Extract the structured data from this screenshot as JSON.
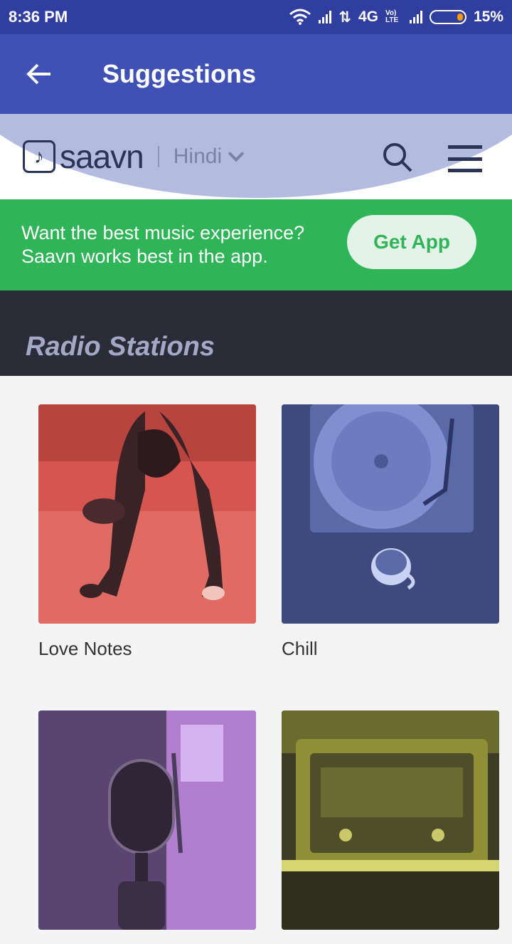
{
  "status_bar": {
    "time": "8:36 PM",
    "network": "4G",
    "battery": "15%",
    "volte": "Vo) LTE"
  },
  "app_bar": {
    "title": "Suggestions"
  },
  "saavn": {
    "logo": "saavn",
    "language": "Hindi"
  },
  "promo": {
    "line1": "Want the best music experience?",
    "line2": "Saavn works best in the app.",
    "button": "Get App"
  },
  "section": {
    "title": "Radio Stations"
  },
  "stations": [
    {
      "label": "Love Notes",
      "tint": "#d9534f"
    },
    {
      "label": "Chill",
      "tint": "#46558f"
    },
    {
      "label": "",
      "tint": "#8c62a6"
    },
    {
      "label": "",
      "tint": "#b8b83a"
    }
  ],
  "colors": {
    "status_bar": "#303f9f",
    "app_bar": "#3f51b5",
    "promo": "#2fb457",
    "section_bg": "#2a2d38"
  }
}
